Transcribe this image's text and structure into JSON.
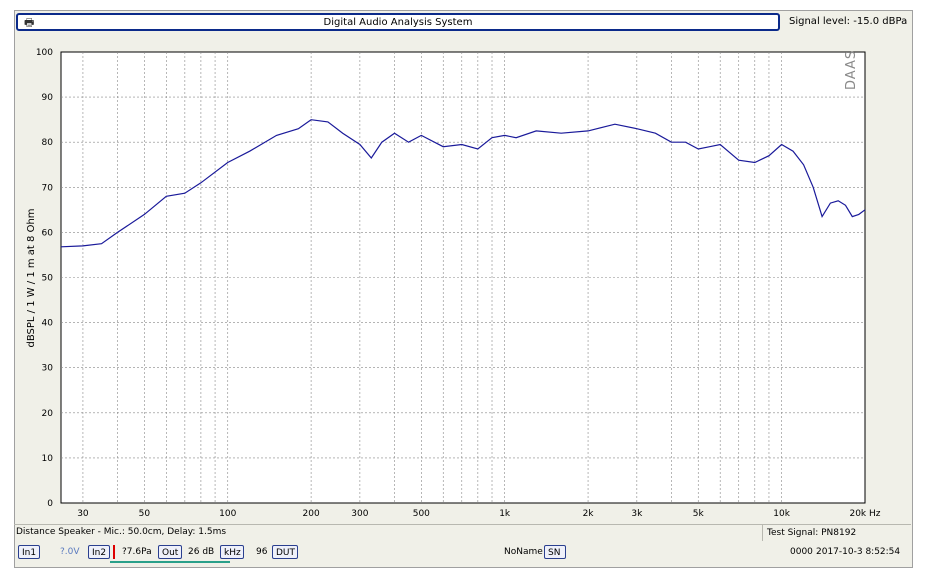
{
  "window": {
    "title": "Digital Audio Analysis System",
    "signal_level": "Signal level: -15.0 dBPa",
    "watermark": "DAAS",
    "print_icon": "printer-icon"
  },
  "status": {
    "measurement_info": "Distance Speaker - Mic.: 50.0cm, Delay: 1.5ms",
    "test_signal": "Test Signal: PN8192"
  },
  "bottom_bar": {
    "in1": "In1",
    "in1_value": "?.0V",
    "in2": "In2",
    "in2_value": "?7.6Pa",
    "out": "Out",
    "out_value": "26 dB",
    "khz": "kHz",
    "khz_value": "96",
    "dut": "DUT",
    "name": "NoName",
    "sn": "SN",
    "counter": "0000",
    "datetime": "2017-10-3 8:52:54"
  },
  "chart_data": {
    "type": "line",
    "ylabel": "dBSPL / 1 W / 1 m at 8 Ohm",
    "xscale": "log",
    "xlim": [
      25,
      20000
    ],
    "ylim": [
      0,
      100
    ],
    "grid": true,
    "x_ticks": [
      30,
      50,
      100,
      200,
      300,
      500,
      1000,
      2000,
      3000,
      5000,
      10000,
      20000
    ],
    "x_tick_labels": [
      "30",
      "50",
      "100",
      "200",
      "300",
      "500",
      "1k",
      "2k",
      "3k",
      "5k",
      "10k",
      "20k Hz"
    ],
    "y_ticks": [
      0,
      10,
      20,
      30,
      40,
      50,
      60,
      70,
      80,
      90,
      100
    ],
    "y_tick_labels": [
      "0",
      "10",
      "20",
      "30",
      "40",
      "50",
      "60",
      "70",
      "80",
      "90",
      "100"
    ],
    "line_color": "#1a1a9a",
    "series": [
      {
        "x": [
          25,
          30,
          35,
          40,
          50,
          60,
          70,
          80,
          100,
          120,
          150,
          180,
          200,
          230,
          260,
          300,
          330,
          360,
          400,
          450,
          500,
          600,
          700,
          800,
          900,
          1000,
          1100,
          1300,
          1600,
          2000,
          2500,
          3000,
          3500,
          4000,
          4500,
          5000,
          5500,
          6000,
          7000,
          8000,
          9000,
          10000,
          11000,
          12000,
          13000,
          14000,
          15000,
          16000,
          17000,
          18000,
          19000,
          20000
        ],
        "y": [
          56.8,
          57.0,
          57.5,
          60.0,
          64.0,
          68.0,
          68.7,
          71.0,
          75.5,
          78.0,
          81.5,
          83.0,
          85.0,
          84.5,
          82.0,
          79.5,
          76.5,
          80.0,
          82.0,
          80.0,
          81.5,
          79.0,
          79.5,
          78.5,
          81.0,
          81.5,
          81.0,
          82.5,
          82.0,
          82.5,
          84.0,
          83.0,
          82.0,
          80.0,
          80.0,
          78.5,
          79.0,
          79.5,
          76.0,
          75.5,
          77.0,
          79.5,
          78.0,
          75.0,
          70.0,
          63.5,
          66.5,
          67.0,
          66.0,
          63.5,
          64.0,
          65.0
        ]
      }
    ]
  }
}
